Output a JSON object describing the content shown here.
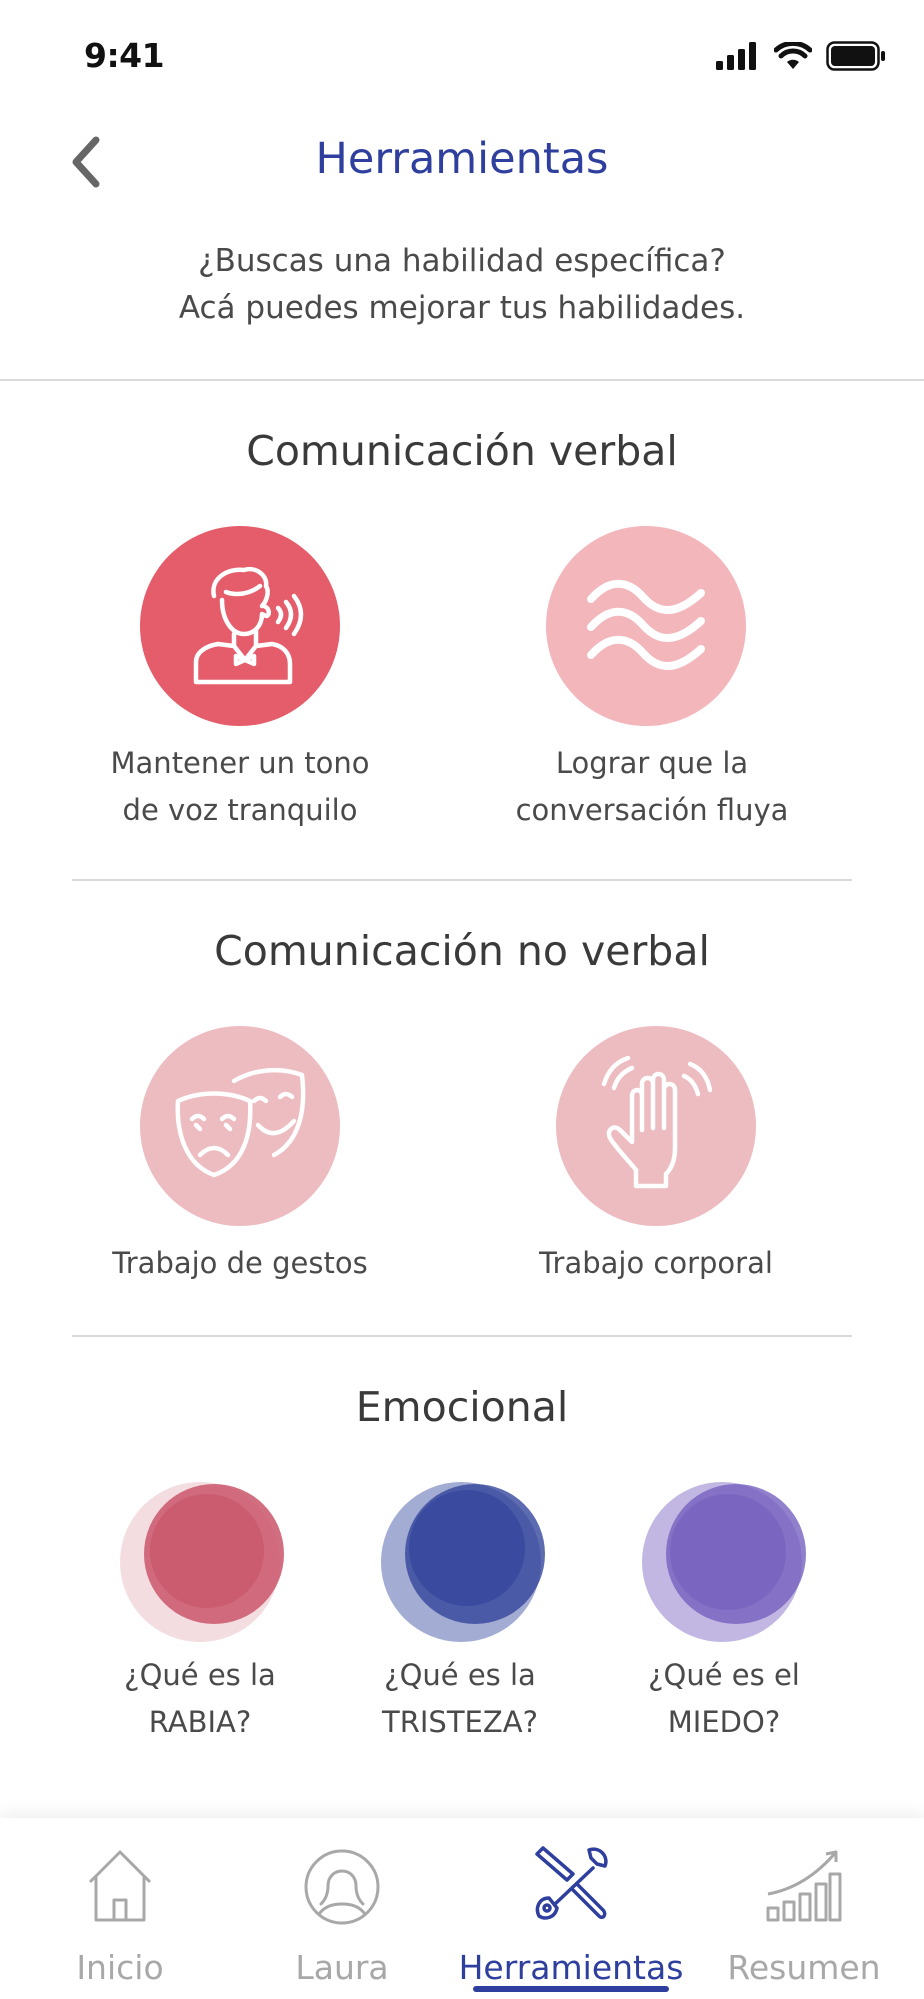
{
  "status_bar": {
    "time": "9:41"
  },
  "header": {
    "title": "Herramientas",
    "subtitle_line1": "¿Buscas una habilidad específica?",
    "subtitle_line2": "Acá puedes mejorar tus habilidades."
  },
  "sections": {
    "verbal": {
      "title": "Comunicación verbal",
      "items": [
        {
          "label_line1": "Mantener un tono",
          "label_line2": "de voz tranquilo",
          "icon": "speaking-person-icon",
          "color": "#e55d6b"
        },
        {
          "label_line1": "Lograr que la",
          "label_line2": "conversación fluya",
          "icon": "waves-icon",
          "color": "#f2b6bb"
        }
      ]
    },
    "nonverbal": {
      "title": "Comunicación no verbal",
      "items": [
        {
          "label": "Trabajo de gestos",
          "icon": "theater-masks-icon",
          "color": "#edbcc0"
        },
        {
          "label": "Trabajo corporal",
          "icon": "waving-hand-icon",
          "color": "#edbcc0"
        }
      ]
    },
    "emotional": {
      "title": "Emocional",
      "items": [
        {
          "label_line1": "¿Qué es la",
          "label_line2": "RABIA?",
          "color": "#c9566a"
        },
        {
          "label_line1": "¿Qué es la",
          "label_line2": "TRISTEZA?",
          "color": "#34469c"
        },
        {
          "label_line1": "¿Qué es el",
          "label_line2": "MIEDO?",
          "color": "#7560bf"
        }
      ]
    }
  },
  "tabbar": {
    "tabs": [
      {
        "label": "Inicio",
        "icon": "home-icon",
        "active": false
      },
      {
        "label": "Laura",
        "icon": "user-icon",
        "active": false
      },
      {
        "label": "Herramientas",
        "icon": "tools-icon",
        "active": true
      },
      {
        "label": "Resumen",
        "icon": "chart-icon",
        "active": false
      }
    ],
    "active_color": "#2f3f9e",
    "inactive_color": "#a8a8a8"
  }
}
